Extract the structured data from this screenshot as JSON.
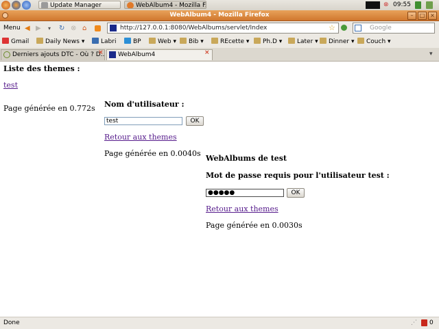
{
  "system_panel": {
    "task_update_manager": "Update Manager",
    "task_firefox": "WebAlbum4 - Mozilla F...",
    "clock": "09:55"
  },
  "window": {
    "title": "WebAlbum4 - Mozilla Firefox"
  },
  "nav": {
    "menu_label": "Menu",
    "url": "http://127.0.0.1:8080/WebAlbums/servlet/Index",
    "search_placeholder": "Google"
  },
  "bookmarks": [
    {
      "label": "Gmail"
    },
    {
      "label": "Daily News"
    },
    {
      "label": "Labri"
    },
    {
      "label": "BP"
    },
    {
      "label": "Web"
    },
    {
      "label": "Bib"
    },
    {
      "label": "REcette"
    },
    {
      "label": "Ph.D"
    },
    {
      "label": "Later"
    },
    {
      "label": "Dinner"
    },
    {
      "label": "Couch"
    }
  ],
  "tabs": [
    {
      "label": "Derniers ajouts DTC - Où ? D..."
    },
    {
      "label": "WebAlbum4"
    }
  ],
  "frame1": {
    "heading": "Liste des themes :",
    "theme_link": "test",
    "generated": "Page générée en 0.772s"
  },
  "frame2": {
    "label": "Nom d'utilisateur :",
    "username_value": "test",
    "ok_label": "OK",
    "back_link": "Retour aux themes",
    "generated": "Page générée en 0.0040s"
  },
  "frame3": {
    "title": "WebAlbums de test",
    "label": "Mot de passe requis pour l'utilisateur test :",
    "password_value": "●●●●●",
    "ok_label": "OK",
    "back_link": "Retour aux themes",
    "generated": "Page générée en 0.0030s"
  },
  "status": {
    "text": "Done",
    "counter": "0"
  },
  "colors": {
    "titlebar": "#d0772e",
    "link_visited": "#551a8b"
  }
}
